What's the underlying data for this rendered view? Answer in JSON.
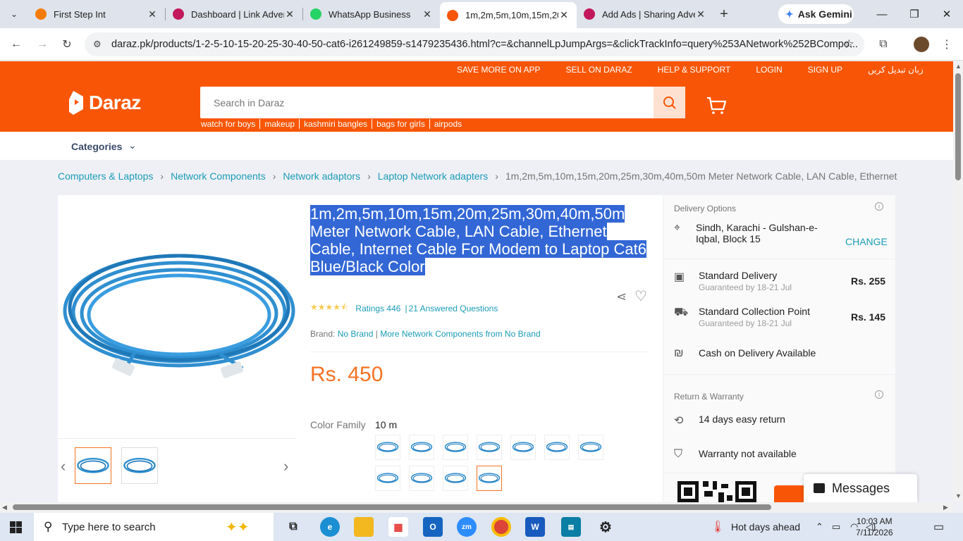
{
  "browser": {
    "tabs": [
      {
        "title": "First Step Int",
        "color": "#f57c00"
      },
      {
        "title": "Dashboard | Link Adver",
        "color": "#c2185b"
      },
      {
        "title": "WhatsApp Business",
        "color": "#25d366"
      },
      {
        "title": "1m,2m,5m,10m,15m,20",
        "color": "#f85606",
        "active": true
      },
      {
        "title": "Add Ads | Sharing Adve",
        "color": "#c2185b"
      }
    ],
    "gemini_label": "Ask Gemini",
    "url": "daraz.pk/products/1-2-5-10-15-20-25-30-40-50-cat6-i261249859-s1479235436.html?c=&channelLpJumpArgs=&clickTrackInfo=query%253ANetwork%252BCompo..."
  },
  "site": {
    "top_links": [
      "SAVE MORE ON APP",
      "SELL ON DARAZ",
      "HELP & SUPPORT",
      "LOGIN",
      "SIGN UP",
      "زبان تبدیل کریں"
    ],
    "logo_text": "Daraz",
    "search_placeholder": "Search in Daraz",
    "hot_words": [
      "watch for boys",
      "makeup",
      "kashmiri bangles",
      "bags for girls",
      "airpods"
    ],
    "categories_label": "Categories",
    "brand_color": "#f85606"
  },
  "breadcrumbs": [
    "Computers & Laptops",
    "Network Components",
    "Network adaptors",
    "Laptop Network adapters"
  ],
  "breadcrumb_current": "1m,2m,5m,10m,15m,20m,25m,30m,40m,50m Meter Network Cable, LAN Cable, Ethernet",
  "product": {
    "title": "1m,2m,5m,10m,15m,20m,25m,30m,40m,50m Meter Network Cable, LAN Cable, Ethernet Cable, Internet Cable For Modem to Laptop Cat6 Blue/Black Color",
    "rating_stars": 4.5,
    "ratings_text": "Ratings 446",
    "questions_text": "21 Answered Questions",
    "brand_label": "Brand:",
    "brand_value": "No Brand",
    "more_from": "More Network Components from No Brand",
    "price": "Rs. 450",
    "color_family_label": "Color Family",
    "color_family_value": "10 m",
    "swatch_count": 11,
    "selected_swatch": 11,
    "thumbnail_count": 2,
    "selected_thumbnail": 1
  },
  "delivery": {
    "title": "Delivery Options",
    "location": "Sindh, Karachi - Gulshan-e-Iqbal, Block 15",
    "change_label": "CHANGE",
    "options": [
      {
        "name": "Standard Delivery",
        "eta": "Guaranteed by 18-21 Jul",
        "fee": "Rs. 255"
      },
      {
        "name": "Standard Collection Point",
        "eta": "Guaranteed by 18-21 Jul",
        "fee": "Rs. 145"
      }
    ],
    "cod": "Cash on Delivery Available",
    "return_title": "Return & Warranty",
    "return_text": "14 days easy return",
    "warranty_text": "Warranty not available"
  },
  "messages_label": "Messages",
  "taskbar": {
    "search_placeholder": "Type here to search",
    "weather": "Hot days ahead",
    "time": "10:03 AM",
    "date": "7/11/2026"
  }
}
